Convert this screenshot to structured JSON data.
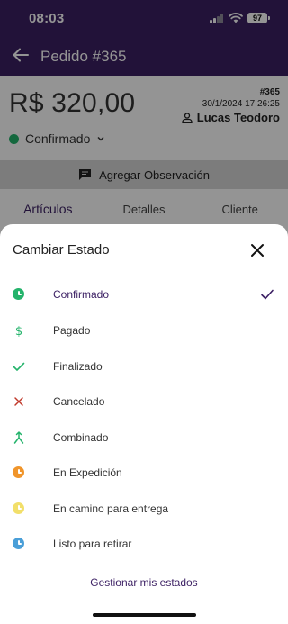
{
  "status_bar": {
    "time": "08:03",
    "battery": "97"
  },
  "header": {
    "title": "Pedido #365"
  },
  "order": {
    "amount": "R$ 320,00",
    "number": "#365",
    "datetime": "30/1/2024 17:26:25",
    "customer": "Lucas Teodoro",
    "status": "Confirmado"
  },
  "observation_button": "Agregar Observación",
  "tabs": [
    {
      "label": "Artículos"
    },
    {
      "label": "Detalles"
    },
    {
      "label": "Cliente"
    }
  ],
  "sheet": {
    "title": "Cambiar Estado",
    "options": [
      {
        "label": "Confirmado",
        "icon": "clock-icon",
        "color": "#24b36b",
        "selected": true
      },
      {
        "label": "Pagado",
        "icon": "dollar-icon",
        "color": "#24b36b"
      },
      {
        "label": "Finalizado",
        "icon": "check-icon",
        "color": "#24b36b"
      },
      {
        "label": "Cancelado",
        "icon": "x-icon",
        "color": "#c0392b"
      },
      {
        "label": "Combinado",
        "icon": "merge-icon",
        "color": "#24b36b"
      },
      {
        "label": "En Expedición",
        "icon": "clock-icon",
        "color": "#f0952b"
      },
      {
        "label": "En camino para entrega",
        "icon": "clock-icon",
        "color": "#f2df6a"
      },
      {
        "label": "Listo para retirar",
        "icon": "clock-icon",
        "color": "#4a9fd8"
      }
    ],
    "manage_link": "Gestionar mis estados"
  }
}
